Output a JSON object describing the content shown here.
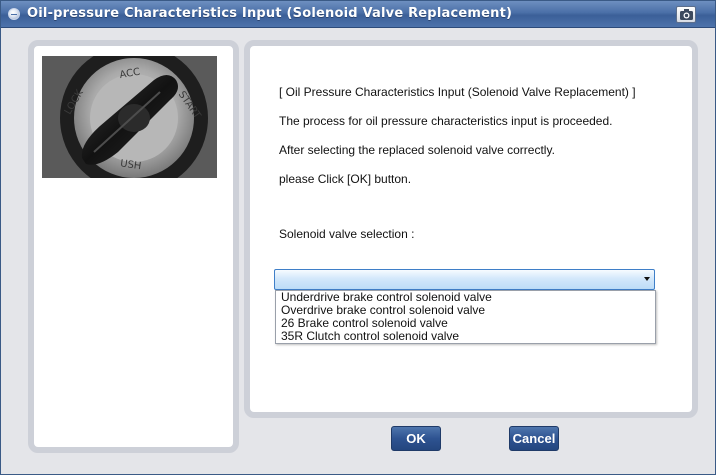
{
  "window": {
    "title": "Oil-pressure Characteristics Input (Solenoid Valve Replacement)",
    "icons": [
      "app-icon",
      "camera-icon"
    ]
  },
  "instructions": {
    "heading": "[  Oil Pressure Characteristics Input (Solenoid Valve Replacement)  ]",
    "line1": "The process for oil pressure characteristics input is proceeded.",
    "line2": "After selecting the replaced solenoid valve correctly.",
    "line3": "please Click [OK] button.",
    "selection_label": "Solenoid valve selection  :"
  },
  "solenoid_select": {
    "selected": "",
    "options": [
      "Underdrive brake control solenoid valve",
      "Overdrive brake control solenoid valve",
      "26 Brake control solenoid valve",
      "35R Clutch control solenoid valve"
    ]
  },
  "buttons": {
    "ok": "OK",
    "cancel": "Cancel"
  },
  "colors": {
    "title_bar": "#4a6fa7",
    "button": "#2e5391",
    "select_highlight": "#bcdcf7",
    "panel_border": "#cdd0d8"
  }
}
